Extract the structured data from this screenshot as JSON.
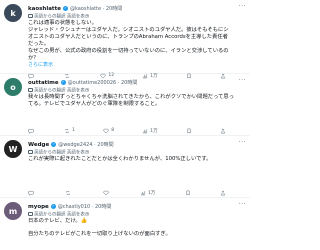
{
  "posts": [
    {
      "avatar_color": "#3a4a5a",
      "avatar_letter": "k",
      "display_name": "kaoshlatte",
      "handle": "@kaoshlatte · 20時間",
      "translated": "英語からの翻訳 英語を表示",
      "lines": [
        "これは適事の状態をしない。",
        "ジャレッド・クシュナーはユダヤ人だ。シオニストのユダヤ人だ。彼はそもそもにシ",
        "オニストのユダヤ人だというのに、トランプのAbraham Accordsを主導した責任者",
        "だった。",
        "なぜこの男が、公式の政府の役割を一切持っていないのに、イランと交渉しているの",
        "か？"
      ],
      "link": "さらに表示",
      "stats": {
        "replies": "",
        "retweets": "",
        "likes": "12",
        "views": "1万"
      }
    },
    {
      "avatar_color": "#2e7d6b",
      "avatar_letter": "o",
      "display_name": "outtatime",
      "handle": "@outtatime200026 · 20時間",
      "translated": "英語からの翻訳 英語を表示",
      "lines": [
        "我々は長時間ずっとちゃくちゃ洗脳されてきたから、これがクソでかい問題だって思っ",
        "てる。テレビでユダヤ人がどのぐ軍隊を制限すること。"
      ],
      "link": "",
      "stats": {
        "replies": "",
        "retweets": "1",
        "likes": "8",
        "views": "1万"
      }
    },
    {
      "avatar_color": "#222222",
      "avatar_letter": "W",
      "display_name": "Wedge",
      "handle": "@wedge2424 · 20時間",
      "translated": "英語からの翻訳 英語を表示",
      "lines": [
        "これが実際に起きれたことだとかは全くわかりませんが、100%正しいです。"
      ],
      "link": "",
      "stats": {
        "replies": "",
        "retweets": "",
        "likes": "",
        "views": "1万"
      }
    },
    {
      "avatar_color": "#6b5d7a",
      "avatar_letter": "m",
      "display_name": "myope",
      "handle": "@chastly010 · 20時間",
      "translated": "英語からの翻訳 英語を表示",
      "lines": [
        "日本のテレビ、だけ。👍",
        "",
        "自分たちのテレビがこれを一切取り上げないのが面白すぎ。"
      ],
      "link": "",
      "stats": {
        "replies": "",
        "retweets": "",
        "likes": "",
        "views": ""
      }
    }
  ],
  "colors": {
    "accent": "#1d9bf0",
    "muted": "#536471",
    "text": "#0f1419"
  }
}
